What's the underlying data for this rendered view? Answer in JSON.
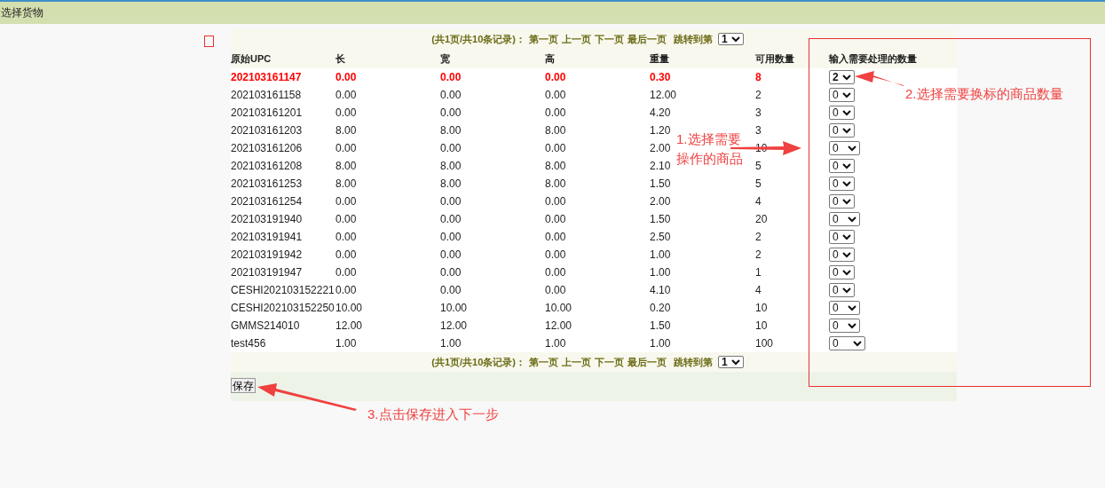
{
  "window": {
    "title": "选择货物"
  },
  "pager_top": {
    "summary": "(共1页/共10条记录)：",
    "links": [
      "第一页",
      "上一页",
      "下一页",
      "最后一页"
    ],
    "jump_label": "跳转到第",
    "page": "1"
  },
  "table": {
    "columns": [
      "原始UPC",
      "长",
      "宽",
      "高",
      "重量",
      "可用数量",
      "输入需要处理的数量"
    ],
    "rows": [
      {
        "cells": [
          "202103161147",
          "0.00",
          "0.00",
          "0.00",
          "0.30",
          "8"
        ],
        "quantity": "2",
        "selected": true
      },
      {
        "cells": [
          "202103161158",
          "0.00",
          "0.00",
          "0.00",
          "12.00",
          "2"
        ],
        "quantity": "0",
        "selected": false
      },
      {
        "cells": [
          "202103161201",
          "0.00",
          "0.00",
          "0.00",
          "4.20",
          "3"
        ],
        "quantity": "0",
        "selected": false
      },
      {
        "cells": [
          "202103161203",
          "8.00",
          "8.00",
          "8.00",
          "1.20",
          "3"
        ],
        "quantity": "0",
        "selected": false
      },
      {
        "cells": [
          "202103161206",
          "0.00",
          "0.00",
          "0.00",
          "2.00",
          "10"
        ],
        "quantity": "0",
        "selected": false
      },
      {
        "cells": [
          "202103161208",
          "8.00",
          "8.00",
          "8.00",
          "2.10",
          "5"
        ],
        "quantity": "0",
        "selected": false
      },
      {
        "cells": [
          "202103161253",
          "8.00",
          "8.00",
          "8.00",
          "1.50",
          "5"
        ],
        "quantity": "0",
        "selected": false
      },
      {
        "cells": [
          "202103161254",
          "0.00",
          "0.00",
          "0.00",
          "2.00",
          "4"
        ],
        "quantity": "0",
        "selected": false
      },
      {
        "cells": [
          "202103191940",
          "0.00",
          "0.00",
          "0.00",
          "1.50",
          "20"
        ],
        "quantity": "0",
        "selected": false
      },
      {
        "cells": [
          "202103191941",
          "0.00",
          "0.00",
          "0.00",
          "2.50",
          "2"
        ],
        "quantity": "0",
        "selected": false
      },
      {
        "cells": [
          "202103191942",
          "0.00",
          "0.00",
          "0.00",
          "1.00",
          "2"
        ],
        "quantity": "0",
        "selected": false
      },
      {
        "cells": [
          "202103191947",
          "0.00",
          "0.00",
          "0.00",
          "1.00",
          "1"
        ],
        "quantity": "0",
        "selected": false
      },
      {
        "cells": [
          "CESHI202103152221",
          "0.00",
          "0.00",
          "0.00",
          "4.10",
          "4"
        ],
        "quantity": "0",
        "selected": false
      },
      {
        "cells": [
          "CESHI202103152250",
          "10.00",
          "10.00",
          "10.00",
          "0.20",
          "10"
        ],
        "quantity": "0",
        "selected": false
      },
      {
        "cells": [
          "GMMS214010",
          "12.00",
          "12.00",
          "12.00",
          "1.50",
          "10"
        ],
        "quantity": "0",
        "selected": false
      },
      {
        "cells": [
          "test456",
          "1.00",
          "1.00",
          "1.00",
          "1.00",
          "100"
        ],
        "quantity": "0",
        "selected": false
      }
    ]
  },
  "pager_bottom": {
    "summary": "(共1页/共10条记录)：",
    "links": [
      "第一页",
      "上一页",
      "下一页",
      "最后一页"
    ],
    "jump_label": "跳转到第",
    "page": "1"
  },
  "save_button": "保存",
  "annotations": [
    {
      "lines": [
        "1.选择需要",
        "操作的商品"
      ]
    },
    {
      "lines": [
        "2.选择需要换标的商品数量"
      ]
    },
    {
      "lines": [
        "3.点击保存进入下一步"
      ]
    }
  ]
}
